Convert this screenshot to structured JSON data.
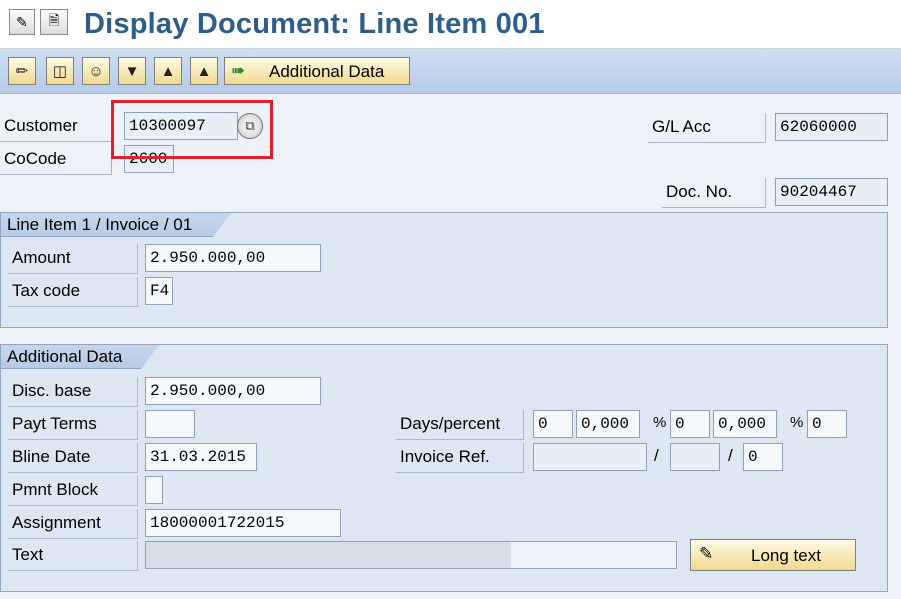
{
  "title": "Display Document: Line Item 001",
  "toolbar": {
    "additional_data_label": "Additional Data"
  },
  "header": {
    "customer_label": "Customer",
    "customer_value": "10300097",
    "cocode_label": "CoCode",
    "cocode_value": "2600",
    "gl_acc_label": "G/L Acc",
    "gl_acc_value": "62060000",
    "doc_no_label": "Doc. No.",
    "doc_no_value": "90204467"
  },
  "line_item_group": {
    "title": "Line Item 1 / Invoice / 01",
    "amount_label": "Amount",
    "amount_value": "2.950.000,00",
    "tax_code_label": "Tax code",
    "tax_code_value": "F4"
  },
  "additional_group": {
    "title": "Additional Data",
    "disc_base_label": "Disc. base",
    "disc_base_value": "2.950.000,00",
    "payt_terms_label": "Payt Terms",
    "payt_terms_value": "",
    "bline_date_label": "Bline Date",
    "bline_date_value": "31.03.2015",
    "pmnt_block_label": "Pmnt Block",
    "pmnt_block_value": "",
    "assignment_label": "Assignment",
    "assignment_value": "18000001722015",
    "text_label": "Text",
    "text_value": "",
    "days_percent_label": "Days/percent",
    "days1": "0",
    "pct1": "0,000",
    "pct_sign": "%",
    "days2": "0",
    "pct2": "0,000",
    "days3": "0",
    "invoice_ref_label": "Invoice Ref.",
    "invoice_ref_value": "",
    "invoice_ref_sep": "/",
    "invoice_ref_year": "",
    "invoice_ref_item": "0",
    "long_text_label": "Long text"
  },
  "colors": {
    "title": "#2f5d8a",
    "highlight": "#e0202a",
    "button": "#efd98e"
  }
}
